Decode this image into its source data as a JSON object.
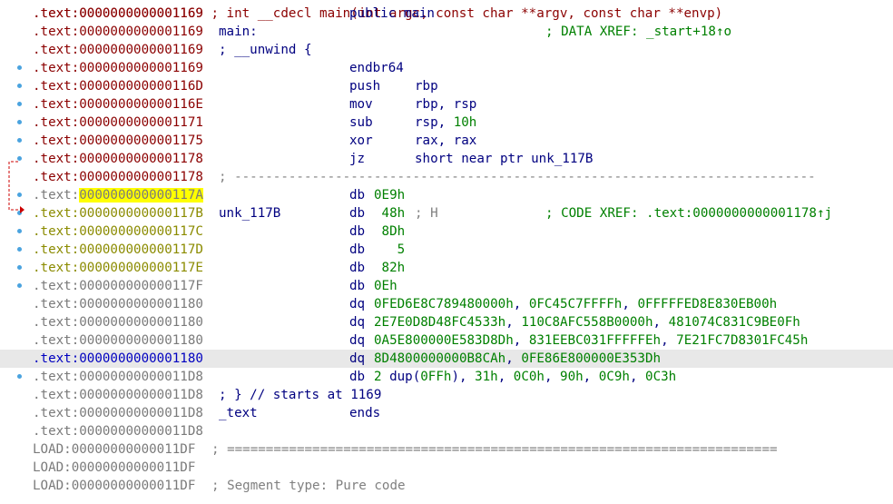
{
  "lines": [
    {
      "id": "l0",
      "addr_prefix": ".text:",
      "addr": "0000000000001169",
      "seg": "text",
      "label": "",
      "mnem": "public main",
      "ops": "",
      "comment": ""
    },
    {
      "id": "l1",
      "addr_prefix": ".text:",
      "addr": "0000000000001169",
      "seg": "text",
      "label": "main:",
      "mnem": "",
      "ops": "",
      "comment": "; DATA XREF: _start+18↑o"
    },
    {
      "id": "l2",
      "addr_prefix": ".text:",
      "addr": "0000000000001169",
      "seg": "text",
      "label": "; __unwind {",
      "mnem": "",
      "ops": "",
      "comment": ""
    },
    {
      "id": "l3",
      "addr_prefix": ".text:",
      "addr": "0000000000001169",
      "seg": "text",
      "label": "",
      "mnem": "endbr64",
      "ops": "",
      "comment": "",
      "bp": true
    },
    {
      "id": "l4",
      "addr_prefix": ".text:",
      "addr": "000000000000116D",
      "seg": "text",
      "label": "",
      "mnem": "push",
      "ops": "rbp",
      "comment": "",
      "bp": true
    },
    {
      "id": "l5",
      "addr_prefix": ".text:",
      "addr": "000000000000116E",
      "seg": "text",
      "label": "",
      "mnem": "mov",
      "ops": "rbp, rsp",
      "comment": "",
      "bp": true
    },
    {
      "id": "l6",
      "addr_prefix": ".text:",
      "addr": "0000000000001171",
      "seg": "text",
      "label": "",
      "mnem": "sub",
      "ops": "rsp, 10h",
      "comment": "",
      "bp": true
    },
    {
      "id": "l7",
      "addr_prefix": ".text:",
      "addr": "0000000000001175",
      "seg": "text",
      "label": "",
      "mnem": "xor",
      "ops": "rax, rax",
      "comment": "",
      "bp": true
    },
    {
      "id": "l8",
      "addr_prefix": ".text:",
      "addr": "0000000000001178",
      "seg": "text",
      "label": "",
      "mnem": "jz",
      "ops": "short near ptr unk_117B",
      "comment": "",
      "bp": true
    },
    {
      "id": "l9",
      "addr_prefix": ".text:",
      "addr": "0000000000001178",
      "seg": "text",
      "label": "; ---------------------------------------------------------------------------",
      "mnem": "",
      "ops": "",
      "comment": "",
      "sep": true
    },
    {
      "id": "l10",
      "addr_prefix": ".text:",
      "addr": "000000000000117A",
      "seg": "grey",
      "label": "",
      "mnem": "db",
      "ops": "0E9h",
      "comment": "",
      "bp": true,
      "hl": true
    },
    {
      "id": "l11",
      "addr_prefix": ".text:",
      "addr": "000000000000117B",
      "seg": "olive",
      "label": "unk_117B",
      "mnem": "db",
      "ops": " 48h",
      "comment": "; CODE XREF: .text:0000000000001178↑j",
      "bp": true,
      "aux": "; H"
    },
    {
      "id": "l12",
      "addr_prefix": ".text:",
      "addr": "000000000000117C",
      "seg": "olive",
      "label": "",
      "mnem": "db",
      "ops": " 8Dh",
      "comment": "",
      "bp": true
    },
    {
      "id": "l13",
      "addr_prefix": ".text:",
      "addr": "000000000000117D",
      "seg": "olive",
      "label": "",
      "mnem": "db",
      "ops": "   5",
      "comment": "",
      "bp": true
    },
    {
      "id": "l14",
      "addr_prefix": ".text:",
      "addr": "000000000000117E",
      "seg": "olive",
      "label": "",
      "mnem": "db",
      "ops": " 82h",
      "comment": "",
      "bp": true
    },
    {
      "id": "l15",
      "addr_prefix": ".text:",
      "addr": "000000000000117F",
      "seg": "grey",
      "label": "",
      "mnem": "db",
      "ops": "0Eh",
      "comment": "",
      "bp": true
    },
    {
      "id": "l16",
      "addr_prefix": ".text:",
      "addr": "0000000000001180",
      "seg": "grey",
      "label": "",
      "mnem": "dq",
      "ops": "0FED6E8C789480000h, 0FC45C7FFFFh, 0FFFFFED8E830EB00h",
      "comment": ""
    },
    {
      "id": "l17",
      "addr_prefix": ".text:",
      "addr": "0000000000001180",
      "seg": "grey",
      "label": "",
      "mnem": "dq",
      "ops": "2E7E0D8D48FC4533h, 110C8AFC558B0000h, 481074C831C9BE0Fh",
      "comment": ""
    },
    {
      "id": "l18",
      "addr_prefix": ".text:",
      "addr": "0000000000001180",
      "seg": "grey",
      "label": "",
      "mnem": "dq",
      "ops": "0A5E800000E583D8Dh, 831EEBC031FFFFFEh, 7E21FC7D8301FC45h",
      "comment": ""
    },
    {
      "id": "l19",
      "addr_prefix": ".text:",
      "addr": "0000000000001180",
      "seg": "blue",
      "label": "",
      "mnem": "dq",
      "ops": "8D4800000000B8CAh, 0FE86E800000E353Dh",
      "comment": "",
      "sel": true
    },
    {
      "id": "l20",
      "addr_prefix": ".text:",
      "addr": "00000000000011D8",
      "seg": "grey",
      "label": "",
      "mnem": "db",
      "ops": "2 dup(0FFh), 31h, 0C0h, 90h, 0C9h, 0C3h",
      "comment": "",
      "bp": true
    },
    {
      "id": "l21",
      "addr_prefix": ".text:",
      "addr": "00000000000011D8",
      "seg": "grey",
      "label": "; } // starts at 1169",
      "mnem": "",
      "ops": "",
      "comment": ""
    },
    {
      "id": "l22",
      "addr_prefix": ".text:",
      "addr": "00000000000011D8",
      "seg": "grey",
      "label": "_text",
      "mnem": "ends",
      "ops": "",
      "comment": ""
    },
    {
      "id": "l23",
      "addr_prefix": ".text:",
      "addr": "00000000000011D8",
      "seg": "grey",
      "label": "",
      "mnem": "",
      "ops": "",
      "comment": ""
    },
    {
      "id": "l24",
      "addr_prefix": "LOAD:",
      "addr": "00000000000011DF",
      "seg": "grey",
      "label": "",
      "mnem": "",
      "ops": "",
      "comment": "",
      "rule": "; ======================================================================="
    },
    {
      "id": "l25",
      "addr_prefix": "LOAD:",
      "addr": "00000000000011DF",
      "seg": "grey",
      "label": "",
      "mnem": "",
      "ops": "",
      "comment": ""
    },
    {
      "id": "l26",
      "addr_prefix": "LOAD:",
      "addr": "00000000000011DF",
      "seg": "grey",
      "label": "",
      "mnem": "",
      "ops": "",
      "comment": "",
      "rule": "; Segment type: Pure code"
    }
  ],
  "top_partial_line": ".text:0000000000001169 ; int __cdecl main(int argc, const char **argv, const char **envp)",
  "colors": {
    "text_seg": "#8b0000",
    "grey_seg": "#7a7a7a",
    "olive_seg": "#8b8b00",
    "blue_seg": "#0000c0",
    "highlight": "#ffff00",
    "selected_row": "#e8e8e8",
    "breakpoint": "#4aa3df",
    "arrow": "#cc0000"
  }
}
